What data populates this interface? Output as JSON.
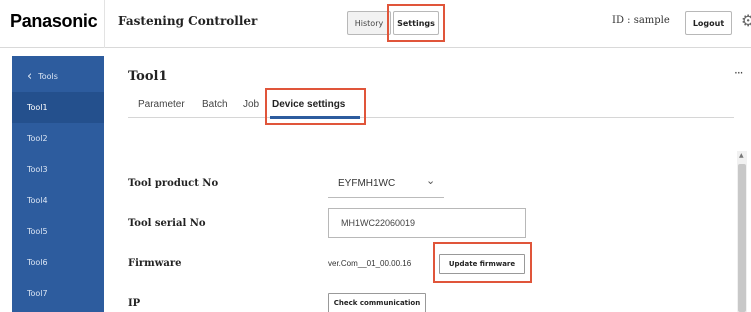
{
  "header": {
    "logo": "Panasonic",
    "app_title": "Fastening Controller",
    "history_label": "History",
    "settings_label": "Settings",
    "user_id": "ID : sample",
    "logout_label": "Logout",
    "gear_glyph": "⚙"
  },
  "sidebar": {
    "back_label": "Tools",
    "items": [
      {
        "label": "Tool1"
      },
      {
        "label": "Tool2"
      },
      {
        "label": "Tool3"
      },
      {
        "label": "Tool4"
      },
      {
        "label": "Tool5"
      },
      {
        "label": "Tool6"
      },
      {
        "label": "Tool7"
      }
    ],
    "active_index": 0
  },
  "main": {
    "title": "Tool1",
    "more": "···",
    "tabs": [
      {
        "label": "Parameter"
      },
      {
        "label": "Batch"
      },
      {
        "label": "Job"
      },
      {
        "label": "Device settings"
      }
    ],
    "active_tab": "Device settings",
    "fields": {
      "product_no_label": "Tool product No",
      "product_no_value": "EYFMH1WC",
      "serial_no_label": "Tool serial No",
      "serial_no_value": "MH1WC22060019",
      "firmware_label": "Firmware",
      "firmware_value": "ver.Com__01_00.00.16",
      "update_firmware_label": "Update firmware",
      "ip_label": "IP",
      "check_communication_label": "Check communication"
    }
  },
  "colors": {
    "sidebar_bg": "#2d5c9e",
    "sidebar_active_bg": "#24508d",
    "highlight": "#e0553a",
    "tab_underline": "#2d5c9e"
  }
}
